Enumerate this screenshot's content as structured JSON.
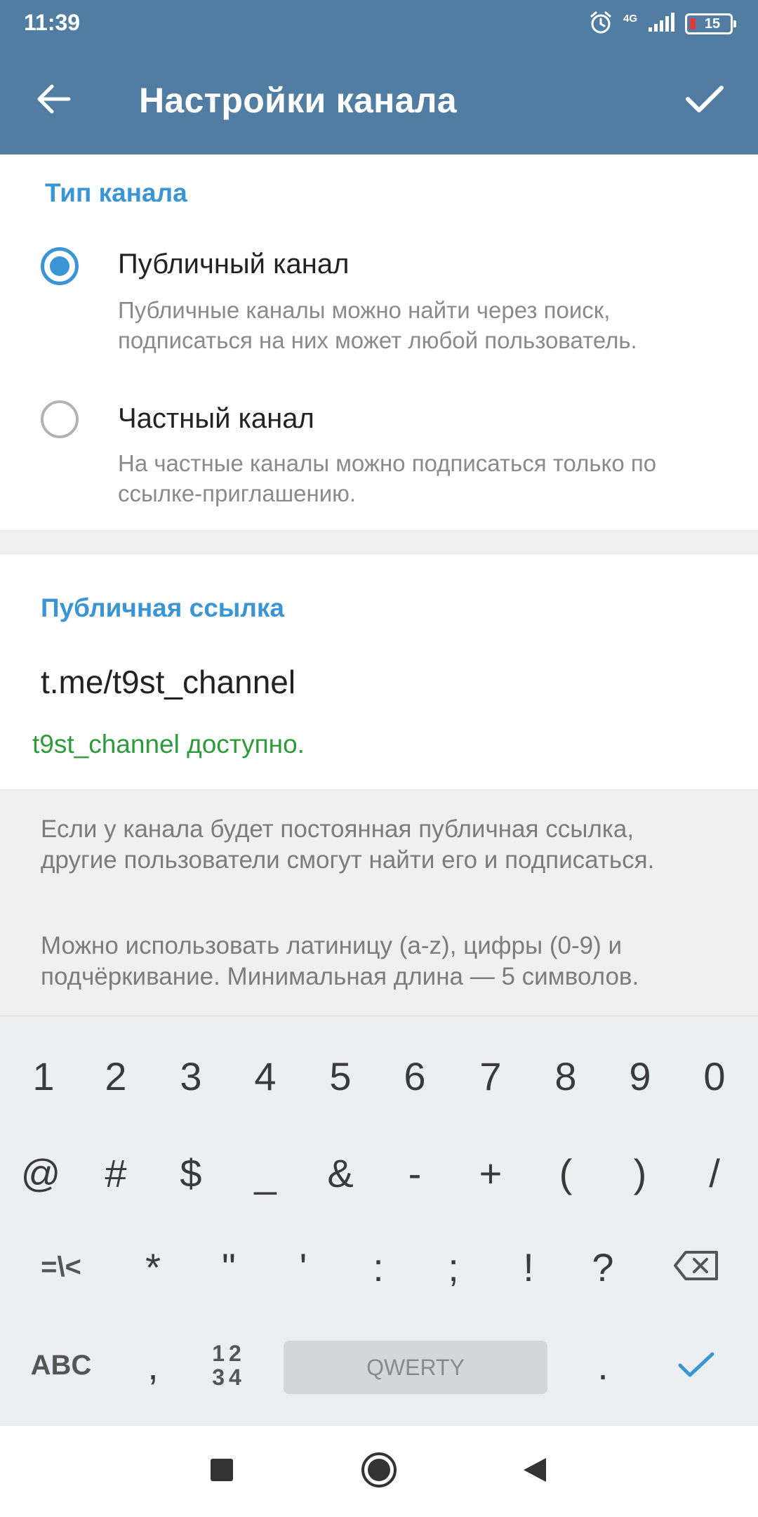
{
  "status_bar": {
    "time": "11:39",
    "network": "4G",
    "battery": "15"
  },
  "toolbar": {
    "title": "Настройки канала",
    "back_icon": "arrow-left-icon",
    "confirm_icon": "check-icon"
  },
  "channel_type": {
    "header": "Тип канала",
    "options": [
      {
        "title": "Публичный канал",
        "description": "Публичные каналы можно найти через поиск, подписаться на них может любой пользователь.",
        "selected": true
      },
      {
        "title": "Частный канал",
        "description": "На частные каналы можно подписаться только по ссылке-приглашению.",
        "selected": false
      }
    ]
  },
  "public_link": {
    "header": "Публичная ссылка",
    "value": "t.me/t9st_channel",
    "status": "t9st_channel доступно."
  },
  "info": {
    "paragraph1": "Если у канала будет постоянная публичная ссылка, другие пользователи смогут найти его и подписаться.",
    "paragraph2": "Можно использовать латиницу (a-z), цифры (0-9) и подчёркивание. Минимальная длина — 5 символов."
  },
  "keyboard": {
    "row1": [
      "1",
      "2",
      "3",
      "4",
      "5",
      "6",
      "7",
      "8",
      "9",
      "0"
    ],
    "row2": [
      "@",
      "#",
      "$",
      "_",
      "&",
      "-",
      "+",
      "(",
      ")",
      "/"
    ],
    "row3": [
      "=\\<",
      "*",
      "\"",
      "'",
      ":",
      ";",
      "!",
      "?"
    ],
    "abc": "ABC",
    "comma": ",",
    "numpad_top": "12",
    "numpad_bottom": "34",
    "space": "QWERTY",
    "period": "."
  },
  "colors": {
    "toolbar": "#527da3",
    "accent": "#3a95d5",
    "success": "#2e9b3a"
  }
}
